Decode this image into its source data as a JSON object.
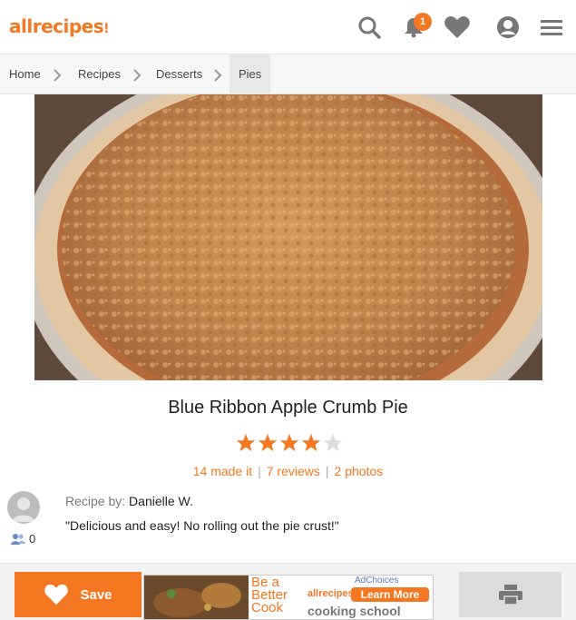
{
  "header": {
    "logo": "allrecipes",
    "notification_count": "1",
    "accent": "#f47721"
  },
  "breadcrumb": [
    "Home",
    "Recipes",
    "Desserts",
    "Pies"
  ],
  "recipe": {
    "title": "Blue Ribbon Apple Crumb Pie",
    "rating": 4,
    "rating_max": 5,
    "made_it": "14 made it",
    "reviews": "7 reviews",
    "photos": "2 photos",
    "byline_label": "Recipe by:",
    "author": "Danielle W.",
    "description": "\"Delicious and easy! No rolling out the pie crust!\"",
    "followers": "0"
  },
  "actions": {
    "save_label": "Save"
  },
  "ad": {
    "choices": "AdChoices",
    "line1": "Be a",
    "line2": "Better",
    "line3": "Cook",
    "brand": "allrecipes",
    "cta": "Learn More",
    "tagline": "cooking school"
  }
}
